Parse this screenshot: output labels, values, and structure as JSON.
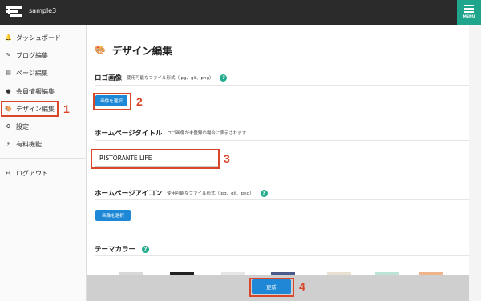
{
  "header": {
    "site_name": "sample3",
    "menu_label": "MENU"
  },
  "sidebar": {
    "items": [
      {
        "icon": "bell-icon",
        "glyph": "🔔",
        "label": "ダッシュボード"
      },
      {
        "icon": "pencil-icon",
        "glyph": "✎",
        "label": "ブログ編集"
      },
      {
        "icon": "pages-icon",
        "glyph": "▤",
        "label": "ページ編集"
      },
      {
        "icon": "user-icon",
        "glyph": "●",
        "label": "会員情報編集"
      },
      {
        "icon": "palette-icon",
        "glyph": "🎨",
        "label": "デザイン編集"
      },
      {
        "icon": "gear-icon",
        "glyph": "⚙",
        "label": "設定"
      },
      {
        "icon": "bolt-icon",
        "glyph": "⚡",
        "label": "有料機能"
      },
      {
        "icon": "logout-icon",
        "glyph": "↦",
        "label": "ログアウト"
      }
    ]
  },
  "main": {
    "title": "デザイン編集",
    "logo_section": {
      "title": "ロゴ画像",
      "note": "使用可能なファイル形式（jpg、gif、png）",
      "button": "画像を選択"
    },
    "homepage_title_section": {
      "title": "ホームページタイトル",
      "note": "ロゴ画像が未登録の場合に表示されます",
      "value": "RISTORANTE LIFE"
    },
    "homepage_icon_section": {
      "title": "ホームページアイコン",
      "note": "使用可能なファイル形式（jpg、gif、png）",
      "button": "画像を選択"
    },
    "theme_color_section": {
      "title": "テーマカラー"
    },
    "help_glyph": "?",
    "update_button": "更新"
  },
  "annotations": [
    "1",
    "2",
    "3",
    "4"
  ],
  "colors": {
    "topbar": "#2b2b2b",
    "accent_teal": "#1fa58b",
    "button_blue": "#1e88d6",
    "annotation_red": "#d9472b"
  }
}
